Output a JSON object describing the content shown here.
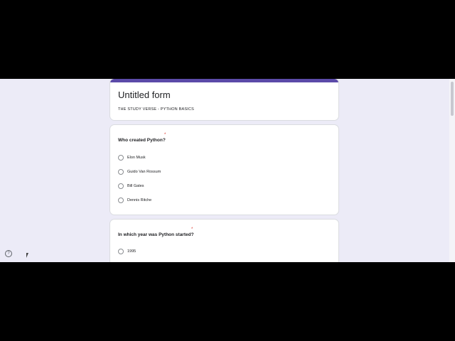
{
  "form": {
    "title": "Untitled form",
    "description": "THE STUDY VERSE - PYTHON BASICS",
    "accent_color": "#5b4aa8"
  },
  "questions": [
    {
      "text": "Who created Python?",
      "required_mark": "*",
      "options": [
        "Elon Musk",
        "Guido Van Rossum",
        "Bill Gates",
        "Dennis Ritche"
      ]
    },
    {
      "text": "In which year was Python started?",
      "required_mark": "*",
      "options": [
        "1995"
      ]
    }
  ],
  "help": {
    "symbol": "?"
  }
}
